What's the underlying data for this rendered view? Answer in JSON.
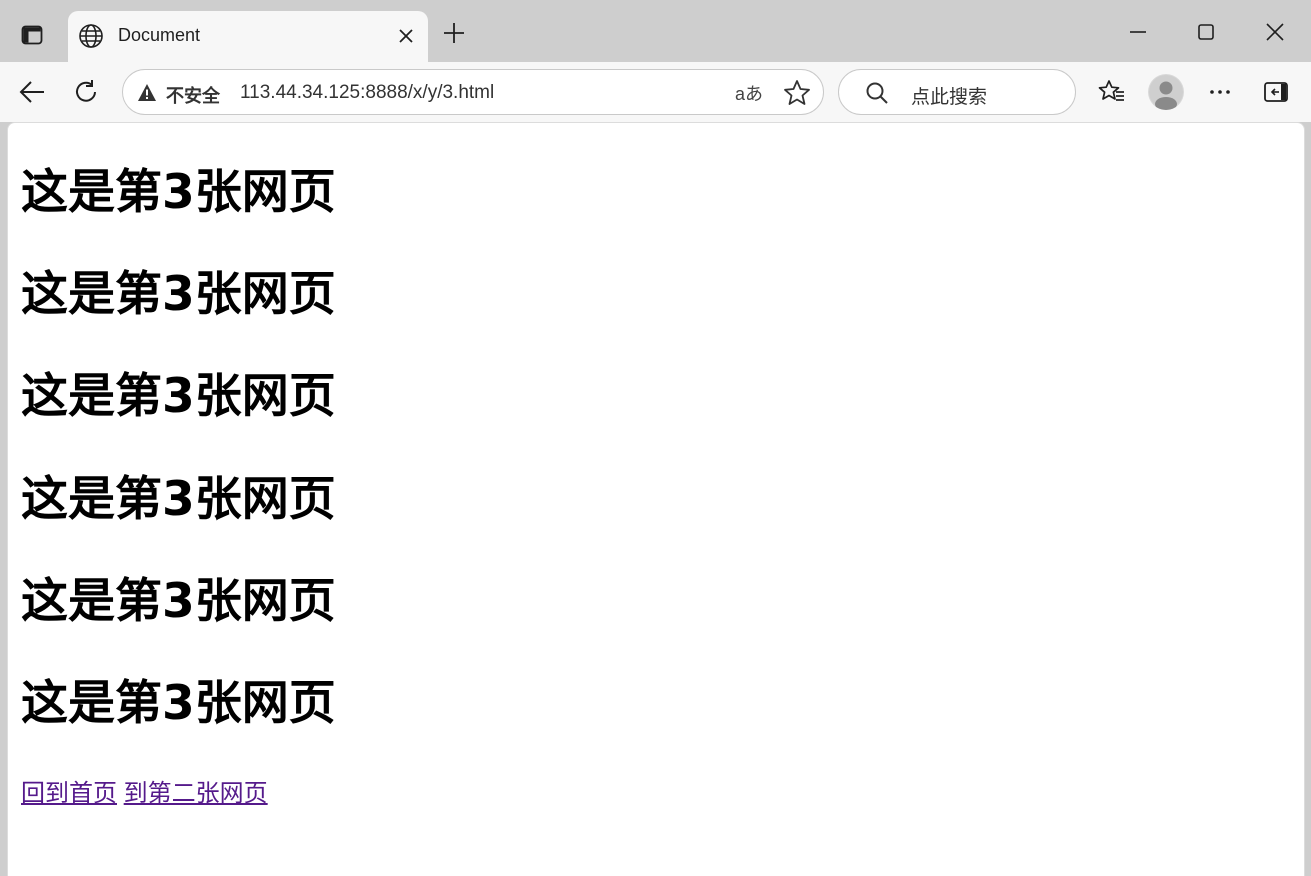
{
  "tab": {
    "title": "Document",
    "favicon": "globe-icon"
  },
  "address": {
    "security_label": "不安全",
    "url": "113.44.34.125:8888/x/y/3.html",
    "read_aloud_glyph": "aあ"
  },
  "search": {
    "placeholder": "点此搜索"
  },
  "page": {
    "headings": [
      "这是第3张网页",
      "这是第3张网页",
      "这是第3张网页",
      "这是第3张网页",
      "这是第3张网页",
      "这是第3张网页"
    ],
    "links": [
      {
        "label": "回到首页"
      },
      {
        "label": "到第二张网页"
      }
    ]
  },
  "colors": {
    "chrome": "#cecece",
    "toolbar": "#f7f7f7",
    "visited_link": "#551a8b"
  }
}
